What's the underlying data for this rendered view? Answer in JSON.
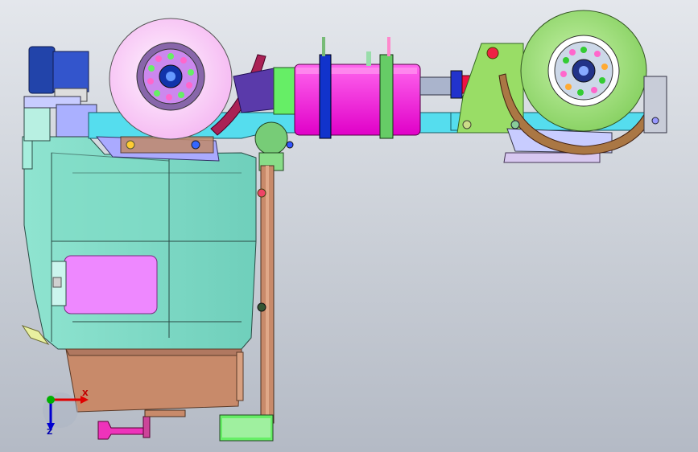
{
  "viewport": {
    "background_top": "#e4e7ec",
    "background_bottom": "#b4bac5"
  },
  "triad": {
    "x_label": "X",
    "z_label": "Z",
    "x_color": "#e00000",
    "y_color": "#00b000",
    "z_color": "#0000d0"
  },
  "colors": {
    "body_cyan": "#8fe0cc",
    "body_outline": "#2a4a44",
    "tank_copper": "#c88a6a",
    "magenta_box": "#ff22dd",
    "violet_panel": "#ee88ff",
    "wheel_pink": "#ffd8ff",
    "wheel_green": "#9be07a",
    "arm_cyan": "#55ddee",
    "motor_blue": "#2244aa",
    "bracket_green": "#99dd66"
  }
}
